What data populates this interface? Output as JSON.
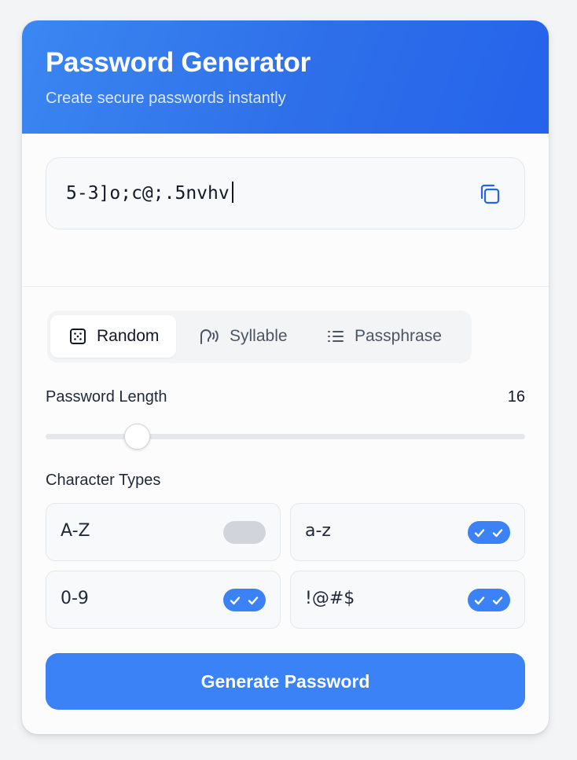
{
  "header": {
    "title": "Password Generator",
    "subtitle": "Create secure passwords instantly"
  },
  "password": {
    "value": "5-3]o;c@;.5nvhv",
    "copy_icon": "copy-icon"
  },
  "modes": {
    "tabs": [
      {
        "label": "Random",
        "icon": "dice-icon",
        "active": true
      },
      {
        "label": "Syllable",
        "icon": "speech-icon",
        "active": false
      },
      {
        "label": "Passphrase",
        "icon": "list-icon",
        "active": false
      }
    ]
  },
  "length": {
    "label": "Password Length",
    "value": "16",
    "slider_fraction": 0.19
  },
  "character_types": {
    "label": "Character Types",
    "options": [
      {
        "label": "A-Z",
        "enabled": false
      },
      {
        "label": "a-z",
        "enabled": true
      },
      {
        "label": "0-9",
        "enabled": true
      },
      {
        "label": "!@#$",
        "enabled": true
      }
    ]
  },
  "generate_button": {
    "label": "Generate Password"
  },
  "colors": {
    "accent": "#3b82f6",
    "header_start": "#3b87f2",
    "header_end": "#2563eb",
    "toggle_off": "#d1d5db"
  }
}
